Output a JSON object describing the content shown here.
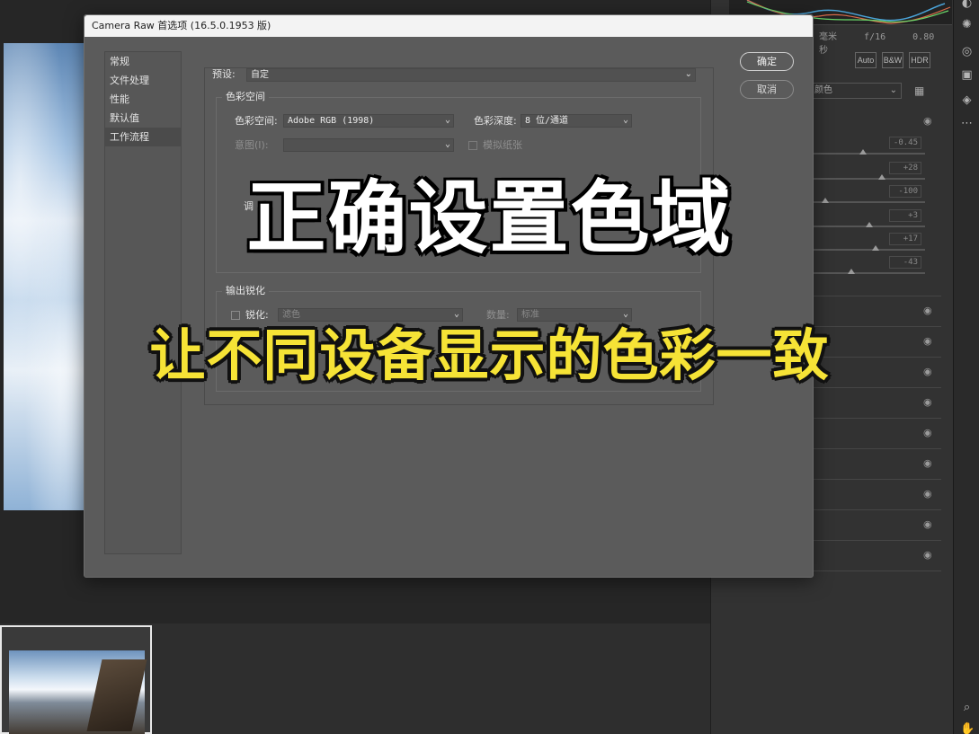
{
  "dialog": {
    "title": "Camera Raw 首选项 (16.5.0.1953 版)",
    "nav_items": [
      "常规",
      "文件处理",
      "性能",
      "默认值",
      "工作流程"
    ],
    "active_nav_index": 4,
    "preset_label": "预设:",
    "preset_value": "自定",
    "color_space_group": "色彩空间",
    "color_space_label": "色彩空间:",
    "color_space_value": "Adobe RGB (1998)",
    "color_depth_label": "色彩深度:",
    "color_depth_value": "8 位/通道",
    "intent_label": "意图(I):",
    "simulate_paper_label": "模拟纸张",
    "sizing_label": "调",
    "output_sharpen_group": "输出锐化",
    "sharpen_label": "锐化:",
    "sharpen_value": "滤色",
    "amount_label": "数量:",
    "amount_value": "标准",
    "ok_button": "确定",
    "cancel_button": "取消"
  },
  "right_panel": {
    "exif_unit": "毫米",
    "exif_fstop": "f/16",
    "exif_shutter": "0.80 秒",
    "mode_buttons": [
      "Auto",
      "B&W",
      "HDR"
    ],
    "profile_value": "颜色",
    "slider_values": [
      "-0.45",
      "+28",
      "-100",
      "+3",
      "+17",
      "-43"
    ],
    "slider_levels": [
      0.45,
      0.62,
      0.12,
      0.51,
      0.56,
      0.35
    ]
  },
  "captions": {
    "title": "正确设置色域",
    "subtitle": "让不同设备显示的色彩一致"
  },
  "colors": {
    "caption_subtitle": "#f6e336",
    "dialog_bg": "#5b5b5b"
  }
}
